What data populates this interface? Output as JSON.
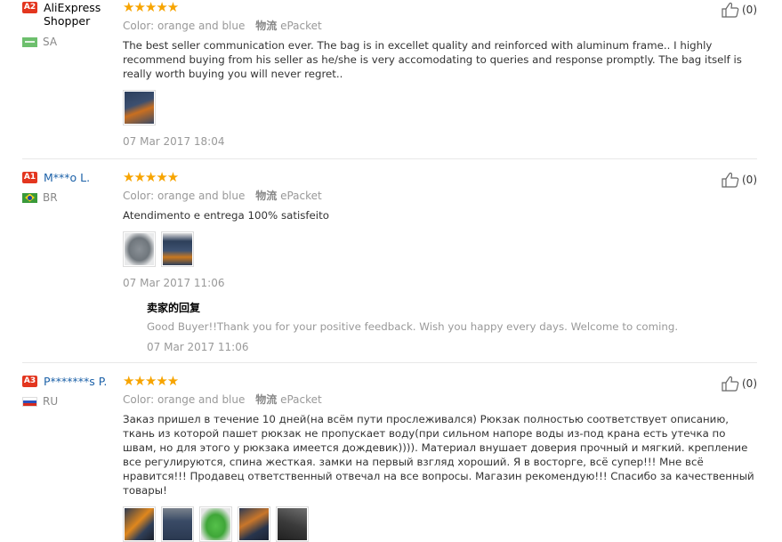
{
  "reviews": [
    {
      "badge": "A2",
      "name": "AliExpress Shopper",
      "country": "SA",
      "stars": "★★★★★",
      "color_label": "Color:",
      "color_value": "orange and blue",
      "ship_label": "物流",
      "ship_value": "ePacket",
      "text": "The best seller communication ever. The bag is in excellet quality and reinforced with aluminum frame.. I highly recommend buying from his seller as he/she is very accomodating to queries and response promptly. The bag itself is really worth buying you will never regret..",
      "date": "07 Mar 2017 18:04",
      "likes": "(0)"
    },
    {
      "badge": "A1",
      "name": "M***o L.",
      "country": "BR",
      "stars": "★★★★★",
      "color_label": "Color:",
      "color_value": "orange and blue",
      "ship_label": "物流",
      "ship_value": "ePacket",
      "text": "Atendimento e entrega 100% satisfeito",
      "date": "07 Mar 2017 11:06",
      "likes": "(0)",
      "reply": {
        "title": "卖家的回复",
        "text": "Good Buyer!!Thank you for your positive feedback. Wish you happy every days. Welcome to coming.",
        "date": "07 Mar 2017 11:06"
      }
    },
    {
      "badge": "A3",
      "name": "P*******s P.",
      "country": "RU",
      "stars": "★★★★★",
      "color_label": "Color:",
      "color_value": "orange and blue",
      "ship_label": "物流",
      "ship_value": "ePacket",
      "text": "Заказ пришел в течение 10 дней(на всём пути прослеживался) Рюкзак полностью соответствует описанию, ткань из которой пашет рюкзак не пропускает воду(при сильном напоре воды из-под крана есть утечка по швам, но для этого у рюкзака имеется дождевик)))). Материал внушает доверия прочный и мягкий. крепление все регулируются, спина жесткая. замки на первый взгляд хороший. Я в восторге, всё супер!!! Мне всё нравится!!! Продавец ответственный отвечал на все вопросы. Магазин рекомендую!!! Спасибо за качественный товары!",
      "likes": "(0)"
    }
  ],
  "colors": {
    "badge": "#e3361f",
    "star": "#f7a400",
    "link": "#1c61a8"
  }
}
